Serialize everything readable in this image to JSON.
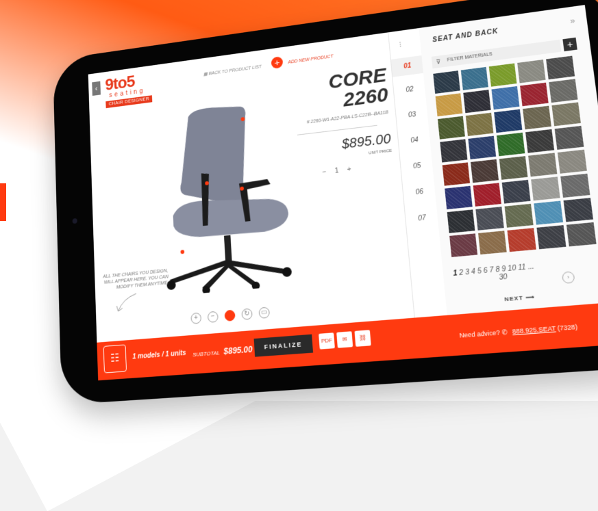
{
  "colors": {
    "brand": "#e83a1c",
    "accent": "#ff3a10",
    "dark": "#2a2a2a"
  },
  "header": {
    "logo_text": "9to5",
    "logo_sub": "seating",
    "badge": "CHAIR DESIGNER",
    "back_to_list": "BACK TO PRODUCT LIST",
    "add_new": "ADD NEW PRODUCT"
  },
  "product": {
    "title_line1": "CORE",
    "title_line2": "2260",
    "sku": "# 2260-W1-A22-PBA-LS-C22B--BA11B",
    "price": "$895.00",
    "unit_price_label": "UNIT PRICE",
    "qty_minus": "−",
    "qty": "1",
    "qty_plus": "+"
  },
  "note": "ALL THE CHAIRS YOU DESIGN, WILL APPEAR HERE. YOU CAN MODIFY THEM ANYTIME.",
  "steps": [
    "01",
    "02",
    "03",
    "04",
    "05",
    "06",
    "07"
  ],
  "materials": {
    "title": "SEAT AND BACK",
    "filter_label": "FILTER MATERIALS",
    "swatch_colors": [
      "#2b3a48",
      "#3a6f8d",
      "#7a9b2a",
      "#8a8a82",
      "#4b4b4b",
      "#c79a44",
      "#2e2e36",
      "#3f6fa8",
      "#9a2430",
      "#6a6a66",
      "#4b5a2e",
      "#7c7244",
      "#1f3a66",
      "#6b6550",
      "#7a7764",
      "#33343a",
      "#2b3e6a",
      "#2f6b28",
      "#3a3a3a",
      "#555",
      "#8a2a1a",
      "#4a3a36",
      "#5b5f4a",
      "#7c7a70",
      "#8a8880",
      "#2a3270",
      "#a01e2a",
      "#3a3f4a",
      "#9a9a96",
      "#6a6a6a",
      "#2c2f33",
      "#4a4d55",
      "#646a50",
      "#4f8fb4",
      "#3a3d44",
      "#6a3a44",
      "#8a6c4a",
      "#b53c2c",
      "#3d3f45",
      "#555"
    ],
    "pages": [
      "1",
      "2",
      "3",
      "4",
      "5",
      "6",
      "7",
      "8",
      "9",
      "10",
      "11",
      "..."
    ],
    "pages_extra": "30",
    "next_label": "NEXT"
  },
  "footer": {
    "models_count": "1",
    "models_label": "models /",
    "units_count": "1",
    "units_label": "units",
    "subtotal_label": "SUBTOTAL",
    "subtotal_value": "$895.00",
    "finalize": "FINALIZE",
    "pdf": "PDF",
    "advice_label": "Need advice?",
    "phone": "888.925.SEAT",
    "phone_extra": "(7328)"
  }
}
